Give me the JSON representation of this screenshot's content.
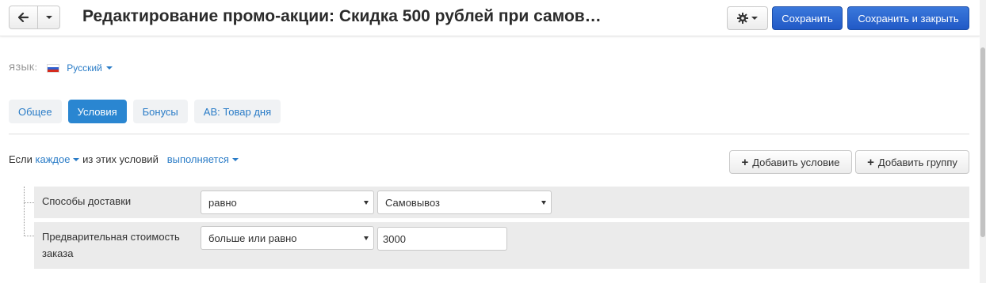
{
  "header": {
    "title": "Редактирование промо-акции: Скидка 500 рублей при самов…",
    "save_label": "Сохранить",
    "save_close_label": "Сохранить и закрыть",
    "back_icon": "arrow-left-icon",
    "settings_icon": "gear-icon"
  },
  "language": {
    "label": "ЯЗЫК:",
    "current": "Русский",
    "flag": "russia-flag-icon"
  },
  "tabs": [
    {
      "label": "Общее",
      "active": false
    },
    {
      "label": "Условия",
      "active": true
    },
    {
      "label": "Бонусы",
      "active": false
    },
    {
      "label": "АВ: Товар дня",
      "active": false
    }
  ],
  "conditions_header": {
    "prefix": "Если",
    "mode": "каждое",
    "middle": "из этих условий",
    "state": "выполняется"
  },
  "buttons": {
    "add_condition": "Добавить условие",
    "add_group": "Добавить группу"
  },
  "conditions": [
    {
      "label": "Способы доставки",
      "operator": "равно",
      "value": "Самовывоз"
    },
    {
      "label": "Предварительная стоимость заказа",
      "operator": "больше или равно",
      "value": "3000"
    }
  ],
  "colors": {
    "primary": "#2159c6",
    "link": "#2a7cc7",
    "active_tab": "#2a86d1"
  }
}
